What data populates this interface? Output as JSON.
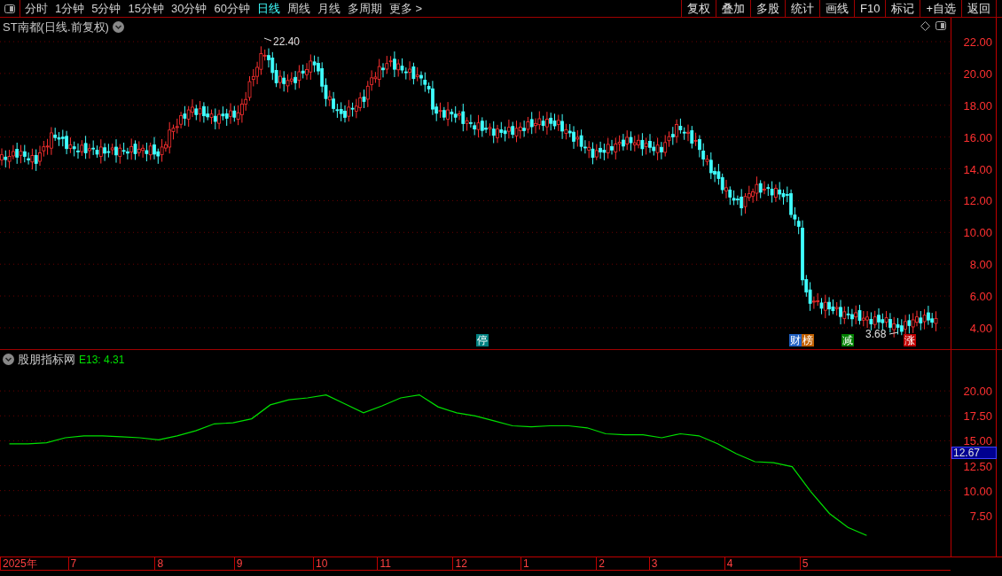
{
  "toolbar": {
    "periods": [
      {
        "label": "分时",
        "selected": false
      },
      {
        "label": "1分钟",
        "selected": false
      },
      {
        "label": "5分钟",
        "selected": false
      },
      {
        "label": "15分钟",
        "selected": false
      },
      {
        "label": "30分钟",
        "selected": false
      },
      {
        "label": "60分钟",
        "selected": false
      },
      {
        "label": "日线",
        "selected": true
      },
      {
        "label": "周线",
        "selected": false
      },
      {
        "label": "月线",
        "selected": false
      },
      {
        "label": "多周期",
        "selected": false
      },
      {
        "label": "更多 >",
        "selected": false
      }
    ],
    "buttons": [
      "复权",
      "叠加",
      "多股",
      "统计",
      "画线",
      "F10",
      "标记",
      "+自选",
      "返回"
    ]
  },
  "price_panel": {
    "title": "ST南都(日线.前复权)",
    "axis_labels": [
      "22.00",
      "20.00",
      "18.00",
      "16.00",
      "14.00",
      "12.00",
      "10.00",
      "8.00",
      "6.00",
      "4.00"
    ],
    "high_label": "22.40",
    "low_label": "3.68",
    "event_marks": [
      {
        "text": "停",
        "color": "#008080"
      },
      {
        "text": "财",
        "color": "#2060c0"
      },
      {
        "text": "榜",
        "color": "#c06000"
      },
      {
        "text": "减",
        "color": "#008000"
      },
      {
        "text": "涨",
        "color": "#c00000"
      }
    ]
  },
  "indicator_panel": {
    "name": "股朋指标网",
    "readout": "E13: 4.31",
    "cursor_value": "12.67",
    "chart_data": {
      "type": "line",
      "grid": true,
      "ylim": [
        3.3,
        24.1
      ],
      "yticks": [
        {
          "value": 20,
          "label": "20.00"
        },
        {
          "value": 17.5,
          "label": "17.50"
        },
        {
          "value": 15,
          "label": "15.00"
        },
        {
          "value": 12.5,
          "label": "12.50"
        },
        {
          "value": 10,
          "label": "10.00"
        },
        {
          "value": 7.5,
          "label": "7.50"
        }
      ],
      "categories": [
        null,
        null,
        null,
        null,
        null,
        null,
        null,
        null,
        null,
        null,
        null,
        null,
        null,
        null,
        null,
        null,
        null,
        null,
        null,
        null,
        null,
        null,
        null,
        null,
        null,
        null,
        null,
        null,
        null,
        null,
        null,
        null,
        null,
        null,
        null,
        null,
        null,
        null,
        null,
        null,
        null,
        null,
        null,
        null,
        null,
        null,
        null,
        null,
        null,
        null,
        null
      ],
      "series": [
        {
          "color": "#00e000",
          "values": [
            14.7,
            14.7,
            14.8,
            15.3,
            15.5,
            15.5,
            15.4,
            15.3,
            15.1,
            15.5,
            16.0,
            16.7,
            16.8,
            17.2,
            18.6,
            19.1,
            19.3,
            19.6,
            18.7,
            17.8,
            18.5,
            19.3,
            19.6,
            18.4,
            17.8,
            17.5,
            17.0,
            16.5,
            16.4,
            16.5,
            16.5,
            16.3,
            15.7,
            15.6,
            15.6,
            15.3,
            15.7,
            15.5,
            14.7,
            13.7,
            12.9,
            12.8,
            12.4,
            9.9,
            7.7,
            6.3,
            5.5,
            null,
            null,
            null,
            null
          ]
        }
      ]
    }
  },
  "date_axis": [
    "2025年",
    "7",
    "8",
    "9",
    "10",
    "11",
    "12",
    "1",
    "2",
    "3",
    "4",
    "5"
  ]
}
